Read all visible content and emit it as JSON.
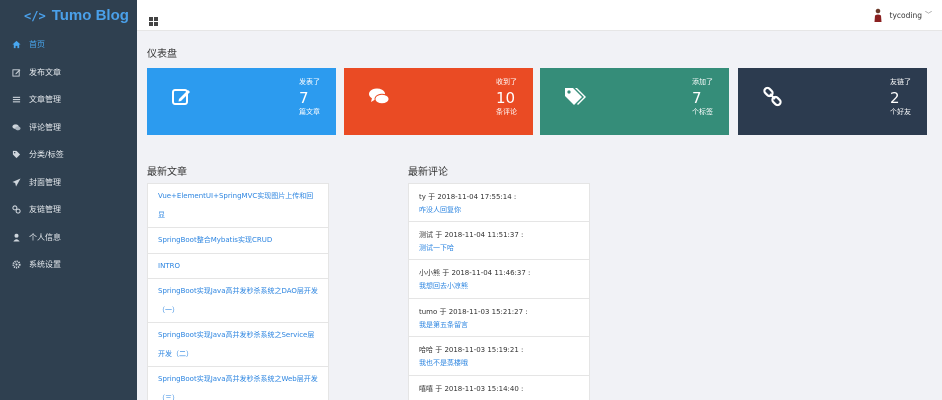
{
  "app": {
    "logo_text": "Tumo Blog",
    "logo_symbol": "</>"
  },
  "sidebar": {
    "items": [
      {
        "label": "首页",
        "icon": "home-icon"
      },
      {
        "label": "发布文章",
        "icon": "edit-icon"
      },
      {
        "label": "文章管理",
        "icon": "list-icon"
      },
      {
        "label": "评论管理",
        "icon": "comments-icon"
      },
      {
        "label": "分类/标签",
        "icon": "tags-icon"
      },
      {
        "label": "封面管理",
        "icon": "send-icon"
      },
      {
        "label": "友链管理",
        "icon": "link-icon"
      },
      {
        "label": "个人信息",
        "icon": "user-icon"
      },
      {
        "label": "系统设置",
        "icon": "gear-icon"
      }
    ]
  },
  "topbar": {
    "username": "tycoding",
    "chevron": "﹀"
  },
  "dashboard": {
    "title": "仪表盘",
    "cards": [
      {
        "line1": "发表了",
        "number": "7",
        "line2": "篇文章",
        "color": "#2c9bef",
        "icon": "edit-icon"
      },
      {
        "line1": "收到了",
        "number": "10",
        "line2": "条评论",
        "color": "#ea4b24",
        "icon": "comments-icon"
      },
      {
        "line1": "添加了",
        "number": "7",
        "line2": "个标签",
        "color": "#358d79",
        "icon": "tags-icon"
      },
      {
        "line1": "友链了",
        "number": "2",
        "line2": "个好友",
        "color": "#2c3b4f",
        "icon": "link-icon"
      }
    ]
  },
  "recent_articles": {
    "title": "最新文章",
    "items": [
      "Vue+ElementUI+SpringMVC实现图片上传和回显",
      "SpringBoot整合Mybatis实现CRUD",
      "INTRO",
      "SpringBoot实现Java高并发秒杀系统之DAO层开发（一）",
      "SpringBoot实现Java高并发秒杀系统之Service层开发（二）",
      "SpringBoot实现Java高并发秒杀系统之Web层开发（三）"
    ]
  },
  "recent_comments": {
    "title": "最新评论",
    "items": [
      {
        "meta": "ty 于 2018-11-04 17:55:14 :",
        "text": "咋没人回复你"
      },
      {
        "meta": "测试 于 2018-11-04 11:51:37 :",
        "text": "测试一下哈"
      },
      {
        "meta": "小小熊 于 2018-11-04 11:46:37 :",
        "text": "我想回去小凉熊"
      },
      {
        "meta": "tumo 于 2018-11-03 15:21:27 :",
        "text": "我是第五条留言"
      },
      {
        "meta": "哈哈 于 2018-11-03 15:19:21 :",
        "text": "我也不是蒸楼哦"
      },
      {
        "meta": "嘻嘻 于 2018-11-03 15:14:40 :",
        "text": ""
      }
    ]
  }
}
